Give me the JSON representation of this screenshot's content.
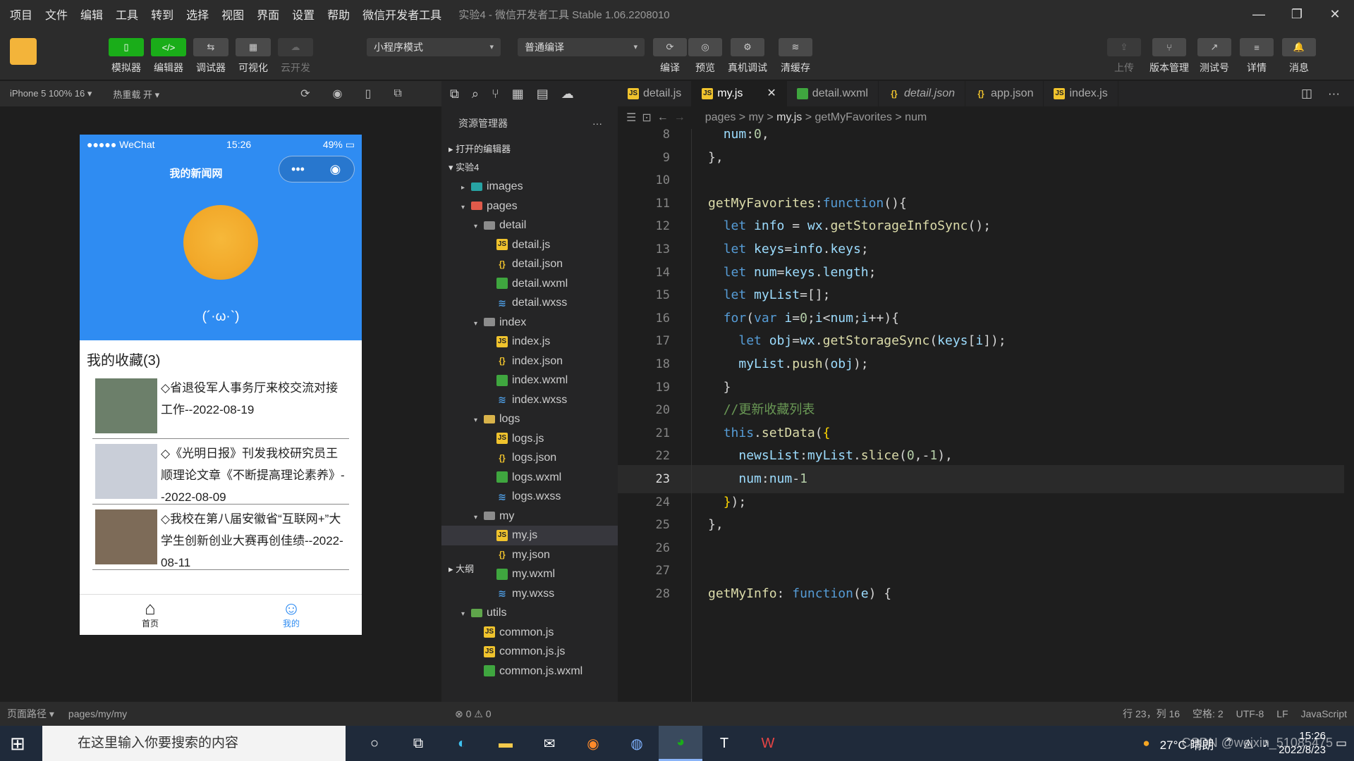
{
  "menubar": {
    "items": [
      "项目",
      "文件",
      "编辑",
      "工具",
      "转到",
      "选择",
      "视图",
      "界面",
      "设置",
      "帮助",
      "微信开发者工具"
    ],
    "title": "实验4 - 微信开发者工具 Stable 1.06.2208010"
  },
  "toolbar": {
    "buttons": [
      {
        "label": "模拟器",
        "glyph": "▯"
      },
      {
        "label": "编辑器",
        "glyph": "</>"
      },
      {
        "label": "调试器",
        "glyph": "⇆"
      },
      {
        "label": "可视化",
        "glyph": "▦"
      },
      {
        "label": "云开发",
        "glyph": "☁"
      }
    ],
    "mode_select": "小程序模式",
    "compile_select": "普通编译",
    "actions": [
      "编译",
      "预览",
      "真机调试",
      "清缓存"
    ],
    "right_actions": [
      "上传",
      "版本管理",
      "测试号",
      "详情",
      "消息"
    ]
  },
  "simulator": {
    "device": "iPhone 5 100% 16 ▾",
    "hot_reload": "热重载 开 ▾",
    "status_left": "●●●●● WeChat",
    "status_time": "15:26",
    "status_battery": "49%",
    "nav_title": "我的新闻网",
    "capsule_more": "•••",
    "capsule_close": "◉",
    "nickname": "(´·ω·`)",
    "fav_title": "我的收藏(3)",
    "news": [
      {
        "text": "◇省退役军人事务厅来校交流对接工作--2022-08-19"
      },
      {
        "text": "◇《光明日报》刊发我校研究员王顺理论文章《不断提高理论素养》--2022-08-09"
      },
      {
        "text": "◇我校在第八届安徽省“互联网+”大学生创新创业大赛再创佳绩--2022-08-11"
      }
    ],
    "tabs": [
      {
        "label": "首页",
        "icon": "⌂"
      },
      {
        "label": "我的",
        "icon": "☺"
      }
    ]
  },
  "explorer": {
    "title": "资源管理器",
    "more": "···",
    "open_editors": "打开的编辑器",
    "project": "实验4",
    "outline": "大纲",
    "tree": [
      {
        "name": "images",
        "type": "folder-img",
        "depth": 1,
        "caret": "▸"
      },
      {
        "name": "pages",
        "type": "folder-pages",
        "depth": 1,
        "caret": "▾"
      },
      {
        "name": "detail",
        "type": "folder",
        "depth": 2,
        "caret": "▾"
      },
      {
        "name": "detail.js",
        "type": "js",
        "depth": 3
      },
      {
        "name": "detail.json",
        "type": "json",
        "depth": 3
      },
      {
        "name": "detail.wxml",
        "type": "wxml",
        "depth": 3
      },
      {
        "name": "detail.wxss",
        "type": "wxss",
        "depth": 3
      },
      {
        "name": "index",
        "type": "folder",
        "depth": 2,
        "caret": "▾"
      },
      {
        "name": "index.js",
        "type": "js",
        "depth": 3
      },
      {
        "name": "index.json",
        "type": "json",
        "depth": 3
      },
      {
        "name": "index.wxml",
        "type": "wxml",
        "depth": 3
      },
      {
        "name": "index.wxss",
        "type": "wxss",
        "depth": 3
      },
      {
        "name": "logs",
        "type": "folder-logs",
        "depth": 2,
        "caret": "▾"
      },
      {
        "name": "logs.js",
        "type": "js",
        "depth": 3
      },
      {
        "name": "logs.json",
        "type": "json",
        "depth": 3
      },
      {
        "name": "logs.wxml",
        "type": "wxml",
        "depth": 3
      },
      {
        "name": "logs.wxss",
        "type": "wxss",
        "depth": 3
      },
      {
        "name": "my",
        "type": "folder",
        "depth": 2,
        "caret": "▾"
      },
      {
        "name": "my.js",
        "type": "js",
        "depth": 3,
        "selected": true
      },
      {
        "name": "my.json",
        "type": "json",
        "depth": 3
      },
      {
        "name": "my.wxml",
        "type": "wxml",
        "depth": 3
      },
      {
        "name": "my.wxss",
        "type": "wxss",
        "depth": 3
      },
      {
        "name": "utils",
        "type": "folder-utils",
        "depth": 1,
        "caret": "▾"
      },
      {
        "name": "common.js",
        "type": "js",
        "depth": 2
      },
      {
        "name": "common.js.js",
        "type": "js",
        "depth": 2
      },
      {
        "name": "common.js.wxml",
        "type": "wxml",
        "depth": 2
      }
    ]
  },
  "editor": {
    "tabs": [
      {
        "name": "detail.js",
        "type": "js"
      },
      {
        "name": "my.js",
        "type": "js",
        "active": true
      },
      {
        "name": "detail.wxml",
        "type": "wxml"
      },
      {
        "name": "detail.json",
        "type": "json"
      },
      {
        "name": "app.json",
        "type": "json"
      },
      {
        "name": "index.js",
        "type": "js"
      }
    ],
    "breadcrumb": [
      "pages",
      "my",
      "my.js",
      "getMyFavorites",
      "num"
    ],
    "current_line": 23,
    "lines": [
      {
        "n": 8,
        "html": "  <span class='prop'>num</span>:<span class='num'>0</span>,"
      },
      {
        "n": 9,
        "html": "},"
      },
      {
        "n": 10,
        "html": ""
      },
      {
        "n": 11,
        "html": "<span class='fn'>getMyFavorites</span>:<span class='kw'>function</span>(){"
      },
      {
        "n": 12,
        "html": "  <span class='kw'>let</span> <span class='var'>info</span> = <span class='var'>wx</span>.<span class='fn'>getStorageInfoSync</span>();"
      },
      {
        "n": 13,
        "html": "  <span class='kw'>let</span> <span class='var'>keys</span>=<span class='var'>info</span>.<span class='prop'>keys</span>;"
      },
      {
        "n": 14,
        "html": "  <span class='kw'>let</span> <span class='var'>num</span>=<span class='var'>keys</span>.<span class='prop'>length</span>;"
      },
      {
        "n": 15,
        "html": "  <span class='kw'>let</span> <span class='var'>myList</span>=[];"
      },
      {
        "n": 16,
        "html": "  <span class='kw'>for</span>(<span class='kw'>var</span> <span class='var'>i</span>=<span class='num'>0</span>;<span class='var'>i</span>&lt;<span class='var'>num</span>;<span class='var'>i</span>++){"
      },
      {
        "n": 17,
        "html": "    <span class='kw'>let</span> <span class='var'>obj</span>=<span class='var'>wx</span>.<span class='fn'>getStorageSync</span>(<span class='var'>keys</span>[<span class='var'>i</span>]);"
      },
      {
        "n": 18,
        "html": "    <span class='var'>myList</span>.<span class='fn'>push</span>(<span class='var'>obj</span>);"
      },
      {
        "n": 19,
        "html": "  }"
      },
      {
        "n": 20,
        "html": "  <span class='cm'>//更新收藏列表</span>"
      },
      {
        "n": 21,
        "html": "  <span class='this'>this</span>.<span class='fn'>setData</span>(<span class='br'>{</span>"
      },
      {
        "n": 22,
        "html": "    <span class='prop'>newsList</span>:<span class='var'>myList</span>.<span class='fn'>slice</span>(<span class='num'>0</span>,-<span class='num'>1</span>),"
      },
      {
        "n": 23,
        "html": "    <span class='prop'>num</span>:<span class='var'>num</span>-<span class='num'>1</span>"
      },
      {
        "n": 24,
        "html": "  <span class='br'>}</span>);"
      },
      {
        "n": 25,
        "html": "},"
      },
      {
        "n": 26,
        "html": ""
      },
      {
        "n": 27,
        "html": ""
      },
      {
        "n": 28,
        "html": "<span class='fn'>getMyInfo</span>: <span class='kw'>function</span>(<span class='var'>e</span>) {"
      }
    ]
  },
  "statusbar": {
    "page_path_label": "页面路径 ▾",
    "page_path": "pages/my/my",
    "problems": "⊗ 0 ⚠ 0",
    "position": "行 23，列 16",
    "spaces": "空格: 2",
    "encoding": "UTF-8",
    "eol": "LF",
    "language": "JavaScript"
  },
  "taskbar": {
    "search_placeholder": "在这里输入你要搜索的内容",
    "weather": "27°C 晴朗",
    "time": "15:26",
    "date": "2022/8/23",
    "watermark": "CSDN @weixin_51085475"
  },
  "colors": {
    "accent_green": "#1aad19",
    "wechat_blue": "#2f8cf2",
    "editor_bg": "#1e1e1e"
  }
}
